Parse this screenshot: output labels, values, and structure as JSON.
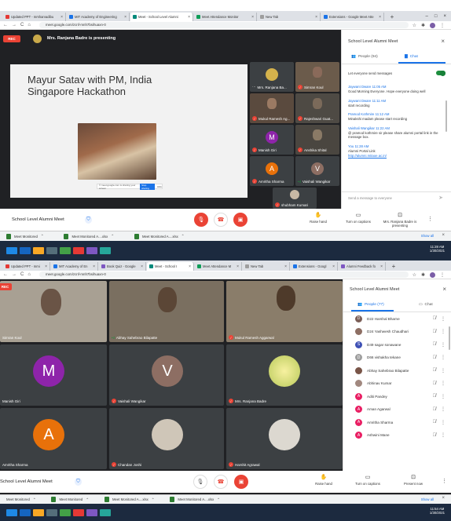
{
  "s1": {
    "tabs": [
      "Updated PPT - mrsharvadibu",
      "MIT Academy of Engineering",
      "Meet - School Level Alumni",
      "Meet Attendance Monitor",
      "New Tab",
      "Extensions - Google Meet Atte"
    ],
    "url": "meet.google.com/zcnf-mnh7bsihuaxn-0",
    "rec": "REC",
    "presenter": "Mrs. Ranjana Badre is presenting",
    "slide_title_1": "Mayur  Satav with PM, India",
    "slide_title_2": "Singapore Hackathon",
    "slide_caption": "© meet.google.com is sharing your screen",
    "slide_stop": "Stop sharing",
    "slide_hide": "Hide",
    "tiles": [
      "Mrs. Ranjana Ba...",
      "Simran Koul",
      "Mukul Ramesh Ag...",
      "Rajeshwari Guat...",
      "Manish Giri",
      "Anshika Shital",
      "Amritha Sharma",
      "Vaishali Wangikar",
      "shubham Kumari"
    ],
    "tile_initials": [
      "",
      "",
      "",
      "",
      "M",
      "",
      "A",
      "V",
      ""
    ],
    "meeting": "School Level Alumni Meet",
    "raise": "Raise hand",
    "captions": "Turn on captions",
    "presenting": "Mrs. Ranjana Badre is presenting",
    "panel": {
      "title": "School Level Alumni Meet",
      "people": "People (94)",
      "chat": "Chat",
      "toggle": "Let everyone send messages",
      "msgs": [
        {
          "from": "Jaywant Dware  11:05 AM",
          "text": "Good Morning Everyone. Hope everyone doing well"
        },
        {
          "from": "Jaywant Dware  11:11 AM",
          "text": "start recording"
        },
        {
          "from": "Pramod Kothmire  11:12 AM",
          "text": "Minakshi madam please start recording"
        },
        {
          "from": "Vaishali Wangikar  11:22 AM",
          "text": "@ pramod kothmire sir please share alumni portal link in the message box."
        },
        {
          "from": "You  11:28 AM",
          "text": "Alumni Portal Link"
        },
        {
          "from": "",
          "text": "http://alumni.mitaoe.ac.in/"
        }
      ],
      "send": "Send a message to everyone"
    },
    "downloads": [
      "Meet Monitored",
      "Meet Monitored A....xlsx",
      "Meet Monitored A....xlsx"
    ],
    "show_all": "Show all",
    "time": "11:28 AM",
    "date": "1/30/2021"
  },
  "s2": {
    "tabs": [
      "Updated PPT - mmi",
      "MIT Academy of En",
      "Book Quiz - Google",
      "Meet - School I",
      "Meet Attendance M",
      "New Tab",
      "Extensions - Googl",
      "Alumni Feedback fo"
    ],
    "url": "meet.google.com/zcnf-mnh7bsihuaxn-0",
    "rec": "REC",
    "tiles": [
      "Simran Koul",
      "Abhay Sahebrao Bilapatte",
      "Mukul Ramesh Aggarwal",
      "Manish Giri",
      "Vaishali Wangikar",
      "Mrs. Ranjana Badre",
      "Amritha Sharma",
      "Chandan Joshi",
      "Harshit Agrawal"
    ],
    "tile_initials": [
      "",
      "",
      "",
      "M",
      "V",
      "",
      "A",
      "",
      ""
    ],
    "meeting": "School Level Alumni Meet",
    "raise": "Raise hand",
    "captions": "Turn on captions",
    "present": "Present now",
    "panel": {
      "title": "School Level Alumni Meet",
      "people": "People (77)",
      "chat": "Chat",
      "people_list": [
        {
          "name": "D22 Harshal Bharne",
          "init": "D",
          "color": "#7b5e57"
        },
        {
          "name": "D24 Yashwesh Chaudhari",
          "init": "",
          "color": "#8d6e63"
        },
        {
          "name": "D49 sagar sonawane",
          "init": "S",
          "color": "#3f51b5"
        },
        {
          "name": "D66 vishakha tekane",
          "init": "D",
          "color": "#9e9e9e"
        },
        {
          "name": "Abhay Sahebrao Bilapatte",
          "init": "",
          "color": "#795548"
        },
        {
          "name": "Abhinav Kumar",
          "init": "",
          "color": "#a1887f"
        },
        {
          "name": "Aditi Pandey",
          "init": "A",
          "color": "#e91e63"
        },
        {
          "name": "Aman Agarwal",
          "init": "A",
          "color": "#e91e63"
        },
        {
          "name": "Amritha Sharma",
          "init": "A",
          "color": "#e91e63"
        },
        {
          "name": "Ashwini Mane",
          "init": "A",
          "color": "#e91e63"
        }
      ]
    },
    "downloads": [
      "Meet Monitored",
      "Meet Monitored",
      "Meet Monitored A....xlsx",
      "Meet Monitored A....xlsx"
    ],
    "show_all": "Show all",
    "time": "11:54 AM",
    "date": "1/30/2021"
  },
  "colors": {
    "accent": "#1a73e8",
    "red": "#ea4335",
    "orange": "#e8710a",
    "purple": "#8e24aa",
    "brown": "#6d4c41",
    "green": "#1e8e3e"
  }
}
